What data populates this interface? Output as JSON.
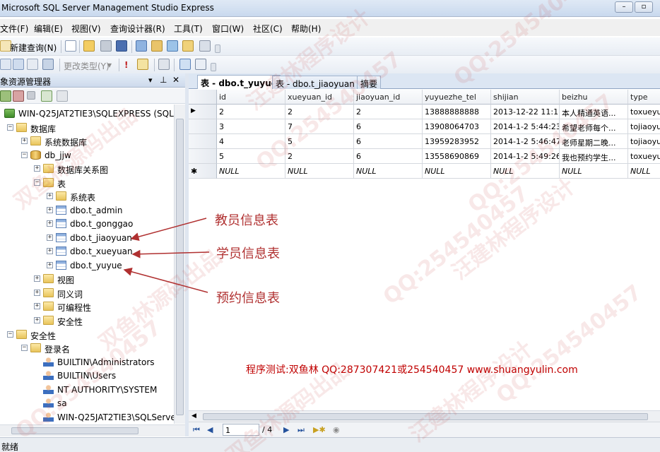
{
  "window": {
    "title": "Microsoft SQL Server Management Studio Express"
  },
  "menu": [
    "文件(F)",
    "编辑(E)",
    "视图(V)",
    "查询设计器(R)",
    "工具(T)",
    "窗口(W)",
    "社区(C)",
    "帮助(H)"
  ],
  "toolbar": {
    "new_query": "新建查询(N)",
    "change_type": "更改类型(Y)"
  },
  "object_explorer": {
    "title": "象资源管理器",
    "server": "WIN-Q25JAT2TIE3\\SQLEXPRESS (SQL",
    "databases": "数据库",
    "system_databases": "系统数据库",
    "db_name": "db_jjw",
    "db_diagrams": "数据库关系图",
    "tables": "表",
    "system_tables": "系统表",
    "table_items": [
      "dbo.t_admin",
      "dbo.t_gonggao",
      "dbo.t_jiaoyuan",
      "dbo.t_xueyuan",
      "dbo.t_yuyue"
    ],
    "views": "视图",
    "synonyms": "同义词",
    "programmability": "可编程性",
    "security_db": "安全性",
    "security": "安全性",
    "logins": "登录名",
    "login_items": [
      "BUILTIN\\Administrators",
      "BUILTIN\\Users",
      "NT AUTHORITY\\SYSTEM",
      "sa",
      "WIN-Q25JAT2TIE3\\SQLServe"
    ]
  },
  "tabs": [
    "表 - dbo.t_yuyue",
    "表 - dbo.t_jiaoyuan",
    "摘要"
  ],
  "grid": {
    "columns": [
      "id",
      "xueyuan_id",
      "jiaoyuan_id",
      "yuyuezhe_tel",
      "shijian",
      "beizhu",
      "type"
    ],
    "rows": [
      [
        "2",
        "2",
        "2",
        "13888888888",
        "2013-12-22 11:1...",
        "本人精通英语...",
        "toxueyua"
      ],
      [
        "3",
        "7",
        "6",
        "13908064703",
        "2014-1-2 5:44:23",
        "希望老师每个...",
        "tojiaoyu"
      ],
      [
        "4",
        "5",
        "6",
        "13959283952",
        "2014-1-2 5:46:47",
        "老师星期二晚...",
        "tojiaoyu"
      ],
      [
        "5",
        "2",
        "6",
        "13558690869",
        "2014-1-2 5:49:26",
        "我也预约学生...",
        "toxueyua"
      ]
    ],
    "new_row": [
      "NULL",
      "NULL",
      "NULL",
      "NULL",
      "NULL",
      "NULL",
      "NULL"
    ],
    "current_marker": "▶",
    "new_marker": "✱"
  },
  "navigator": {
    "current": "1",
    "total": "/ 4"
  },
  "annotations": {
    "teacher": "教员信息表",
    "student": "学员信息表",
    "booking": "预约信息表"
  },
  "footer_text": "程序测试:双鱼林 QQ:287307421或254540457 www.shuangyulin.com",
  "watermarks": [
    "QQ:254540457",
    "双鱼林源码出品",
    "汪建林程序设计"
  ],
  "status": "就绪",
  "colors": {
    "annotation": "#b03030",
    "footer": "#c00000"
  }
}
